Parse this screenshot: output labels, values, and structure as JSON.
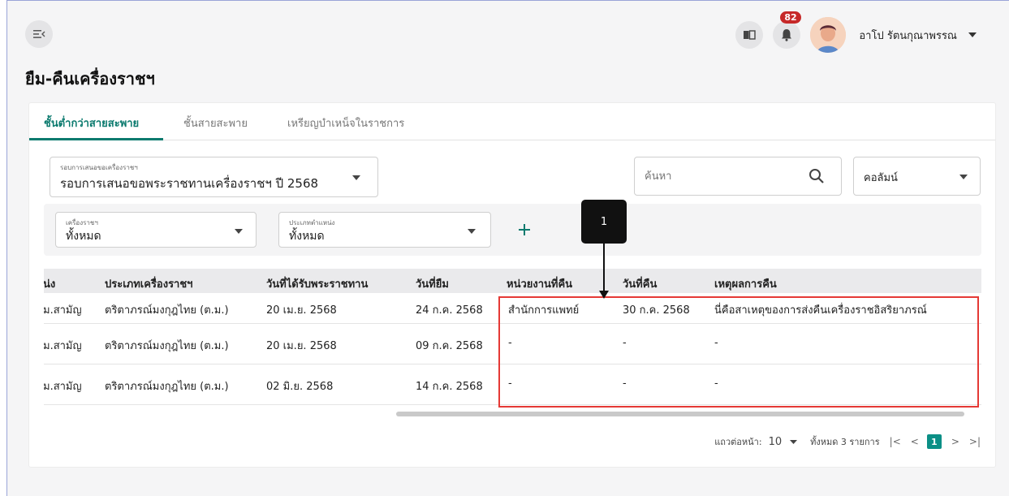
{
  "header": {
    "notification_count": "82",
    "user_name": "อาโป รัตนกุณาพรรณ"
  },
  "page": {
    "title": "ยืม-คืนเครื่องราชฯ"
  },
  "tabs": [
    {
      "label": "ชั้นต่ำกว่าสายสะพาย",
      "active": true
    },
    {
      "label": "ชั้นสายสะพาย",
      "active": false
    },
    {
      "label": "เหรียญบำเหน็จในราชการ",
      "active": false
    }
  ],
  "round_select": {
    "label": "รอบการเสนอขอเครื่องราชฯ",
    "value": "รอบการเสนอขอพระราชทานเครื่องราชฯ ปี 2568"
  },
  "search": {
    "placeholder": "ค้นหา"
  },
  "column_select": {
    "value": "คอลัมน์"
  },
  "filters": {
    "decoration": {
      "label": "เครื่องราชฯ",
      "value": "ทั้งหมด"
    },
    "position_type": {
      "label": "ประเภทตำแหน่ง",
      "value": "ทั้งหมด"
    }
  },
  "table": {
    "headers": [
      "น่ง",
      "ประเภทเครื่องราชฯ",
      "วันที่ได้รับพระราชทาน",
      "วันที่ยืม",
      "หน่วยงานที่คืน",
      "วันที่คืน",
      "เหตุผลการคืน"
    ],
    "rows": [
      [
        "ม.สามัญ",
        "ตริตาภรณ์มงกุฎไทย (ต.ม.)",
        "20 เม.ย. 2568",
        "24 ก.ค. 2568",
        "สำนักการแพทย์",
        "30 ก.ค. 2568",
        "นี่คือสาเหตุของการส่งคืนเครื่องราชอิสริยาภรณ์"
      ],
      [
        "ม.สามัญ",
        "ตริตาภรณ์มงกุฎไทย (ต.ม.)",
        "20 เม.ย. 2568",
        "09 ก.ค. 2568",
        "-",
        "-",
        "-"
      ],
      [
        "ม.สามัญ",
        "ตริตาภรณ์มงกุฎไทย (ต.ม.)",
        "02 มิ.ย. 2568",
        "14 ก.ค. 2568",
        "-",
        "-",
        "-"
      ]
    ]
  },
  "pagination": {
    "rows_per_page_label": "แถวต่อหน้า:",
    "rows_per_page": "10",
    "total_label": "ทั้งหมด 3 รายการ",
    "first": "|<",
    "prev": "<",
    "current_page": "1",
    "next": ">",
    "last": ">|"
  },
  "annotation": {
    "callout_number": "1"
  },
  "colors": {
    "accent": "#0b7a6e",
    "highlight": "#e53935",
    "badge": "#c62828"
  }
}
